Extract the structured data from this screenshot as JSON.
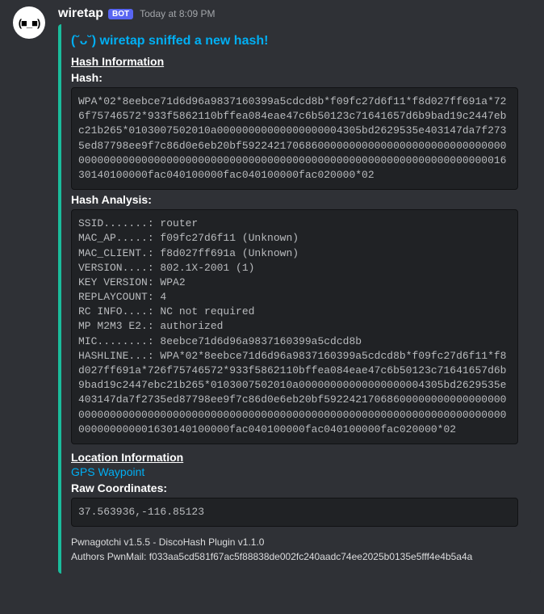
{
  "message": {
    "username": "wiretap",
    "bot_tag": "BOT",
    "timestamp": "Today at 8:09 PM",
    "avatar_text": "(■_■)"
  },
  "embed": {
    "title": "(˘ᴗ˘) wiretap sniffed a new hash!",
    "sections": {
      "hash_info": {
        "heading": "Hash Information",
        "hash_label": "Hash:",
        "hash_value": "WPA*02*8eebce71d6d96a9837160399a5cdcd8b*f09fc27d6f11*f8d027ff691a*726f75746572*933f5862110bffea084eae47c6b50123c71641657d6b9bad19c2447ebc21b265*0103007502010a00000000000000000004305bd2629535e403147da7f2735ed87798ee9f7c86d0e6eb20bf5922421706860000000000000000000000000000000000000000000000000000000000000000000000000000000000000000000000001630140100000fac040100000fac040100000fac020000*02",
        "analysis_label": "Hash Analysis:",
        "analysis_value": "SSID.......: router\nMAC_AP.....: f09fc27d6f11 (Unknown)\nMAC_CLIENT.: f8d027ff691a (Unknown)\nVERSION....: 802.1X-2001 (1)\nKEY VERSION: WPA2\nREPLAYCOUNT: 4\nRC INFO....: NC not required\nMP M2M3 E2.: authorized\nMIC........: 8eebce71d6d96a9837160399a5cdcd8b\nHASHLINE...: WPA*02*8eebce71d6d96a9837160399a5cdcd8b*f09fc27d6f11*f8d027ff691a*726f75746572*933f5862110bffea084eae47c6b50123c71641657d6b9bad19c2447ebc21b265*0103007502010a00000000000000000004305bd2629535e403147da7f2735ed87798ee9f7c86d0e6eb20bf5922421706860000000000000000000000000000000000000000000000000000000000000000000000000000000000000000000000001630140100000fac040100000fac040100000fac020000*02"
      },
      "location_info": {
        "heading": "Location Information",
        "waypoint_label": "GPS Waypoint",
        "raw_coords_label": "Raw Coordinates:",
        "raw_coords_value": "37.563936,-116.85123"
      }
    },
    "footer": {
      "line1": "Pwnagotchi v1.5.5 - DiscoHash Plugin v1.1.0",
      "line2": "Authors PwnMail: f033aa5cd581f67ac5f88838de002fc240aadc74ee2025b0135e5fff4e4b5a4a"
    }
  }
}
